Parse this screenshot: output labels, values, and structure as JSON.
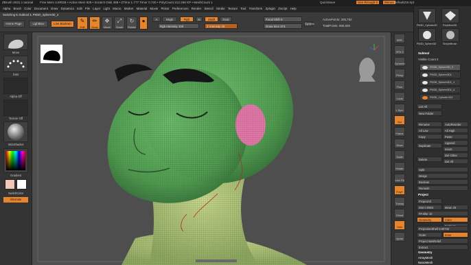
{
  "menubar": {
    "title": "ZBrush 2021.1  tutorial",
    "stats": "Free Mem 2.8RGB • Active Mem 828 • Scratch Disk 488 • ZTime 1.777 Timer 0.720 • PolyCount 212.258 KP • MeshCount 1",
    "items": [
      "Alpha",
      "Brush",
      "Color",
      "Document",
      "Draw",
      "Dynamics",
      "Edit",
      "File",
      "Layer",
      "Light",
      "Macro",
      "Marker",
      "Material",
      "Movie",
      "Picker",
      "Preferences",
      "Render",
      "Stencil",
      "Stroke",
      "Texture",
      "Tool",
      "Transform",
      "Zplugin",
      "Zscript",
      "Help"
    ],
    "quicksave": "QuickSave",
    "see_through": "See-through  0",
    "menus": "Menus",
    "default_zscript": "DefaultZScript"
  },
  "shelf": {
    "switch_hint": "Switching to Subtool 3, PM3D_Sphere3D_3",
    "home_page": "Home Page",
    "lightbox": "LightBox",
    "live_boolean": "Live Boolean",
    "edit": "Edit",
    "draw": "Draw",
    "move": "Move",
    "scale": "Scale",
    "rotate": "Rotate",
    "mrgb": "Mrgb",
    "rgb": "Rgb",
    "m": "M",
    "zadd": "Zadd",
    "zsub": "Zsub",
    "rgb_intensity": "Rgb Intensity 100",
    "z_intensity": "Z Intensity 25",
    "focal_shift": "Focal Shift 0",
    "draw_size": "Draw Size 274",
    "dynamic": "Dynamic",
    "active_points": "ActivePoints: 205,752",
    "total_points": "TotalPoints: 956,928"
  },
  "left": {
    "brush_label": "Move",
    "stroke_label": "Dots",
    "alpha_label": "Alpha Off",
    "texture_label": "Texture Off",
    "material_label": "SkinShade4",
    "gradient_label": "Gradient",
    "switch_color": "SwitchColor",
    "alternate": "Alternate"
  },
  "right_strip": {
    "buttons": [
      "BPR",
      "SPix 3",
      "Dynamic",
      "Persp",
      "Floor",
      "Local",
      "L.Sym",
      "Xyz",
      "Frame",
      "Move",
      "Scale",
      "Rotate",
      "Line Fill",
      "PolyF",
      "Transp",
      "Ghost",
      "Solo",
      "Xpose"
    ]
  },
  "right_panel": {
    "tool_thumbs": [
      "PM3D_Cylinder3D",
      "PolyMesh3D",
      "SimpleBrush",
      "PM3D_Sphere3D"
    ],
    "subtool_header": "Subtool",
    "visible_count": "Visible Count 4",
    "subtools": [
      "PM3D_Sphere3D_3",
      "PM3D_Sphere3D1",
      "PM3D_Sphere3D1_1",
      "PM3D_Sphere3D1_4",
      "PM3D_Cylinder3D1"
    ],
    "list_all": "List All",
    "new_folder": "New Folder",
    "rename": "Rename",
    "auto_reorder": "AutoReorder",
    "all_low": "All Low",
    "all_high": "All High",
    "copy": "Copy",
    "paste": "Paste",
    "append": "Append",
    "duplicate": "Duplicate",
    "insert": "Insert",
    "delete": "Delete",
    "del_other": "Del Other",
    "del_all": "Del All",
    "split": "Split",
    "merge": "Merge",
    "boolean": "Boolean",
    "remesh": "Remesh",
    "project_header": "Project",
    "project_all": "ProjectAll",
    "dist": "Dist 0.0504",
    "mean": "Mean 25",
    "pa_blur": "PA Blur 10",
    "projection_shell": "ProjectionShell 0.00742",
    "geometry": "Geometry",
    "color": "Color",
    "farthest": "Farthest",
    "outer": "Outer",
    "inner": "Inner",
    "project_bas_relief": "Project BasRelief",
    "extract": "Extract",
    "geometry_header": "Geometry",
    "array_mesh": "ArrayMesh",
    "nano_mesh": "NanoMesh"
  },
  "colors": {
    "accent": "#e8842a",
    "skin_green": "#5aa55a",
    "ear_pink": "#e079a8"
  }
}
